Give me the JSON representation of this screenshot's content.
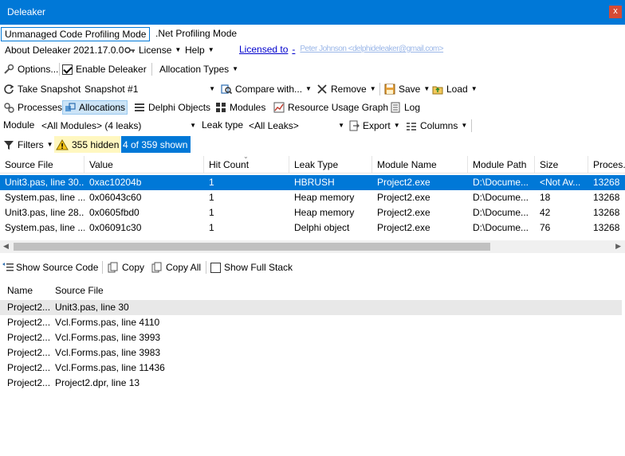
{
  "window": {
    "title": "Deleaker",
    "close_label": "x"
  },
  "mode_tabs": [
    {
      "label": "Unmanaged Code Profiling Mode",
      "active": true
    },
    {
      "label": ".Net Profiling Mode",
      "active": false
    }
  ],
  "menu": {
    "about": "About Deleaker 2021.17.0.0",
    "license": "License",
    "help": "Help",
    "licensed_to": "Licensed to",
    "licensee": "Peter Johnson <delphideleaker@gmail.com>"
  },
  "options_bar": {
    "options": "Options...",
    "enable_deleaker": "Enable Deleaker",
    "enable_checked": true,
    "allocation_types": "Allocation Types"
  },
  "snapshot_bar": {
    "take_snapshot": "Take Snapshot",
    "snapshot_value": "Snapshot #1",
    "compare_with": "Compare with...",
    "remove": "Remove",
    "save": "Save",
    "load": "Load"
  },
  "view_tabs": [
    {
      "label": "Processes",
      "active": false
    },
    {
      "label": "Allocations",
      "active": true
    },
    {
      "label": "Delphi Objects",
      "active": false
    },
    {
      "label": "Modules",
      "active": false
    },
    {
      "label": "Resource Usage Graph",
      "active": false
    },
    {
      "label": "Log",
      "active": false
    }
  ],
  "filter_bar": {
    "module_label": "Module",
    "module_value": "<All Modules> (4 leaks)",
    "leak_type_label": "Leak type",
    "leak_type_value": "<All Leaks>",
    "export": "Export",
    "columns": "Columns"
  },
  "filters_bar": {
    "filters": "Filters",
    "hidden": "355 hidden",
    "shown": "4 of 359 shown"
  },
  "allocations_table": {
    "columns": [
      "Source File",
      "Value",
      "Hit Count",
      "Leak Type",
      "Module Name",
      "Module Path",
      "Size",
      "Proces..."
    ],
    "rows": [
      [
        "Unit3.pas, line 30...",
        "0xac10204b",
        "1",
        "HBRUSH",
        "Project2.exe",
        "D:\\Docume...",
        "<Not Av...",
        "13268"
      ],
      [
        "System.pas, line ...",
        "0x06043c60",
        "1",
        "Heap memory",
        "Project2.exe",
        "D:\\Docume...",
        "18",
        "13268"
      ],
      [
        "Unit3.pas, line 28...",
        "0x0605fbd0",
        "1",
        "Heap memory",
        "Project2.exe",
        "D:\\Docume...",
        "42",
        "13268"
      ],
      [
        "System.pas, line ...",
        "0x06091c30",
        "1",
        "Delphi object",
        "Project2.exe",
        "D:\\Docume...",
        "76",
        "13268"
      ]
    ],
    "selected_row": 0
  },
  "stack_bar": {
    "show_source_code": "Show Source Code",
    "copy": "Copy",
    "copy_all": "Copy All",
    "show_full_stack": "Show Full Stack",
    "show_full_stack_checked": false
  },
  "stack_table": {
    "columns": [
      "Name",
      "Source File"
    ],
    "rows": [
      [
        "Project2...",
        "Unit3.pas, line 30"
      ],
      [
        "Project2...",
        "Vcl.Forms.pas, line 4110"
      ],
      [
        "Project2...",
        "Vcl.Forms.pas, line 3993"
      ],
      [
        "Project2...",
        "Vcl.Forms.pas, line 3983"
      ],
      [
        "Project2...",
        "Vcl.Forms.pas, line 11436"
      ],
      [
        "Project2...",
        "Project2.dpr, line 13"
      ]
    ],
    "selected_row": 0
  },
  "colors": {
    "accent": "#0078d7",
    "warning_bg": "#fff7c0"
  }
}
